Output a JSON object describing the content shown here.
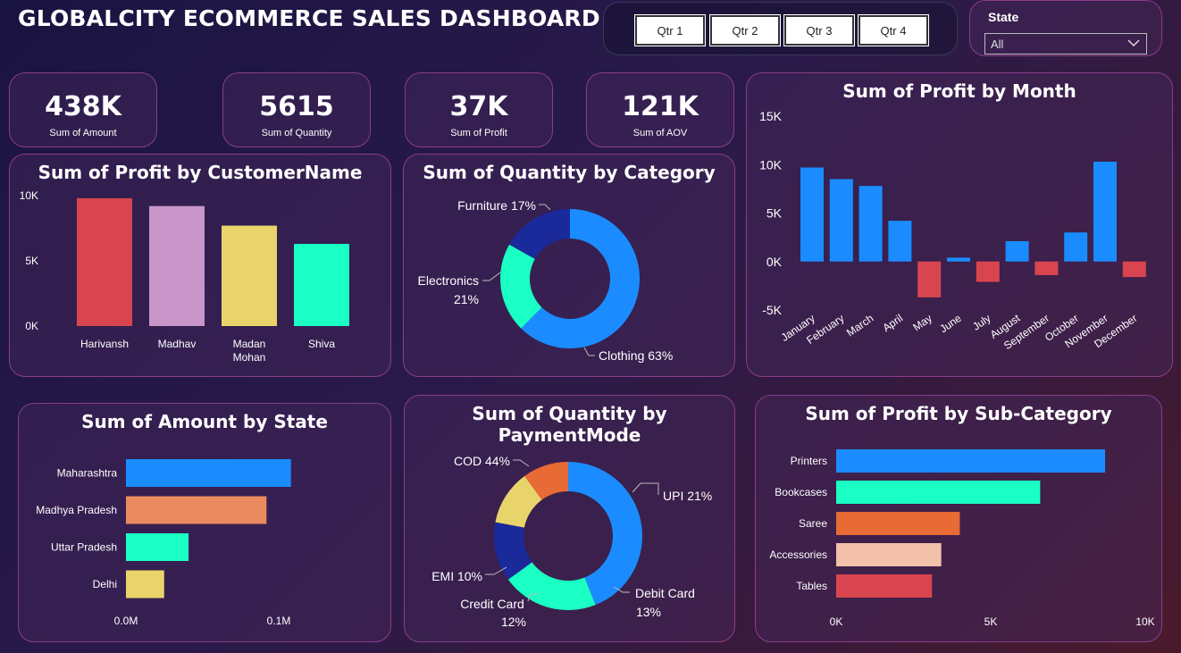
{
  "header": {
    "title": "GLOBALCITY ECOMMERCE SALES DASHBOARD"
  },
  "quarters": [
    "Qtr 1",
    "Qtr 2",
    "Qtr 3",
    "Qtr 4"
  ],
  "state_filter": {
    "label": "State",
    "value": "All",
    "icon": "chevron-down-icon"
  },
  "kpis": [
    {
      "value": "438K",
      "label": "Sum of Amount"
    },
    {
      "value": "5615",
      "label": "Sum of Quantity"
    },
    {
      "value": "37K",
      "label": "Sum of Profit"
    },
    {
      "value": "121K",
      "label": "Sum of AOV"
    }
  ],
  "chart_data": [
    {
      "id": "profit_by_customer",
      "type": "bar",
      "title": "Sum of Profit by CustomerName",
      "categories": [
        "Harivansh",
        "Madhav",
        "Madan Mohan",
        "Shiva"
      ],
      "values": [
        9800,
        9200,
        7700,
        6300
      ],
      "colors": [
        "#d9454f",
        "#c896c8",
        "#e8d46a",
        "#1affc4"
      ],
      "ylim": [
        0,
        10000
      ],
      "yticks": [
        "0K",
        "5K",
        "10K"
      ],
      "grid": false
    },
    {
      "id": "quantity_by_category",
      "type": "pie",
      "title": "Sum of Quantity by Category",
      "categories": [
        "Clothing",
        "Electronics",
        "Furniture"
      ],
      "values": [
        63,
        21,
        17
      ],
      "labels": [
        "Clothing 63%",
        "Electronics 21%",
        "Furniture 17%"
      ],
      "colors": [
        "#1a8cff",
        "#1affc4",
        "#1a2a9a"
      ]
    },
    {
      "id": "profit_by_month",
      "type": "bar",
      "title": "Sum of Profit by Month",
      "categories": [
        "January",
        "February",
        "March",
        "April",
        "May",
        "June",
        "July",
        "August",
        "September",
        "October",
        "November",
        "December"
      ],
      "values": [
        9700,
        8500,
        7800,
        4200,
        -3700,
        400,
        -2100,
        2100,
        -1400,
        3000,
        10300,
        -1600
      ],
      "positive_color": "#1a8cff",
      "negative_color": "#d9454f",
      "ylim": [
        -5000,
        15000
      ],
      "yticks": [
        "-5K",
        "0K",
        "5K",
        "10K",
        "15K"
      ],
      "grid": false
    },
    {
      "id": "amount_by_state",
      "type": "bar",
      "orientation": "horizontal",
      "title": "Sum of Amount by State",
      "categories": [
        "Maharashtra",
        "Madhya Pradesh",
        "Uttar Pradesh",
        "Delhi"
      ],
      "values": [
        0.108,
        0.092,
        0.041,
        0.025
      ],
      "colors": [
        "#1a8cff",
        "#eb8a5e",
        "#1affc4",
        "#e8d46a"
      ],
      "xlim": [
        0,
        0.1
      ],
      "xticks": [
        "0.0M",
        "0.1M"
      ]
    },
    {
      "id": "quantity_by_paymentmode",
      "type": "pie",
      "title": "Sum of Quantity by PaymentMode",
      "categories": [
        "COD",
        "UPI",
        "Debit Card",
        "Credit Card",
        "EMI"
      ],
      "values": [
        44,
        21,
        13,
        12,
        10
      ],
      "labels": [
        "COD 44%",
        "UPI 21%",
        "Debit Card 13%",
        "Credit Card 12%",
        "EMI 10%"
      ],
      "colors": [
        "#1a8cff",
        "#1affc4",
        "#1a2a9a",
        "#e8d46a",
        "#e86a35"
      ]
    },
    {
      "id": "profit_by_subcategory",
      "type": "bar",
      "orientation": "horizontal",
      "title": "Sum of Profit by Sub-Category",
      "categories": [
        "Printers",
        "Bookcases",
        "Saree",
        "Accessories",
        "Tables"
      ],
      "values": [
        8700,
        6600,
        4000,
        3400,
        3100
      ],
      "colors": [
        "#1a8cff",
        "#1affc4",
        "#e86a35",
        "#f3c0aa",
        "#d9454f"
      ],
      "xlim": [
        0,
        10000
      ],
      "xticks": [
        "0K",
        "5K",
        "10K"
      ]
    }
  ]
}
